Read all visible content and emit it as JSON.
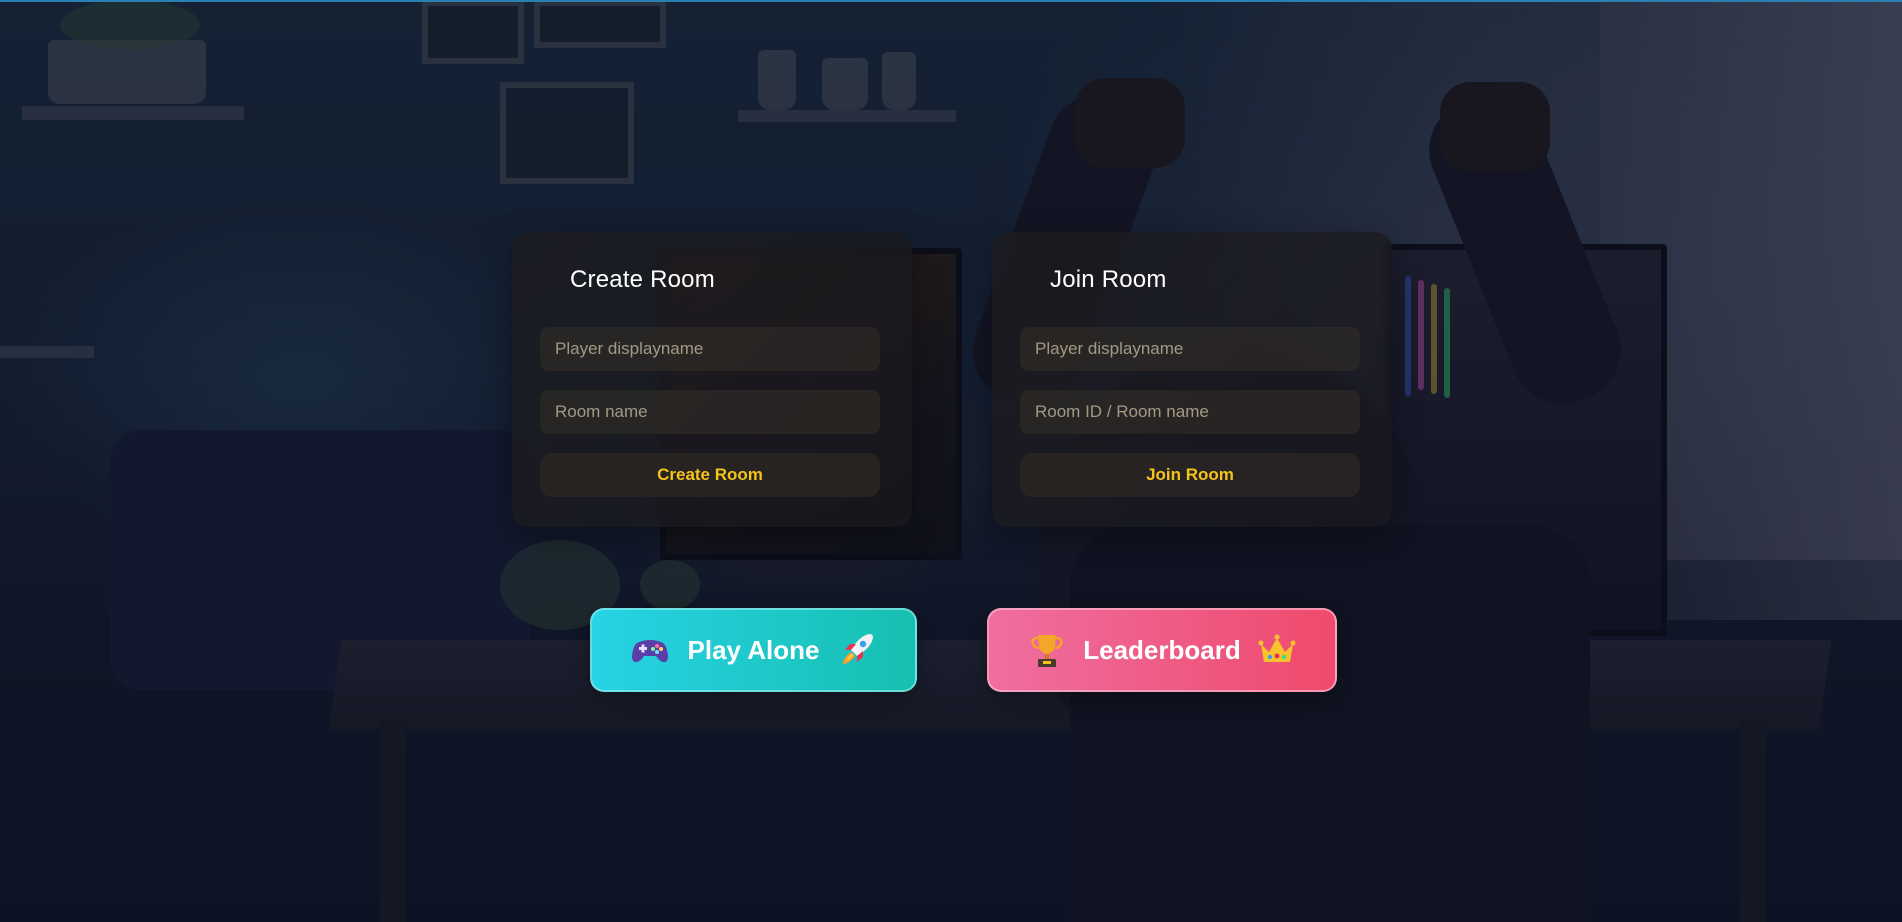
{
  "create_room": {
    "title": "Create Room",
    "name_placeholder": "Player displayname",
    "room_placeholder": "Room name",
    "button_label": "Create Room"
  },
  "join_room": {
    "title": "Join Room",
    "name_placeholder": "Player displayname",
    "room_placeholder": "Room ID / Room name",
    "button_label": "Join Room"
  },
  "actions": {
    "play_alone": {
      "label": "Play Alone",
      "left_icon": "gamepad-icon",
      "right_icon": "rocket-icon",
      "color_from": "#27d3e5",
      "color_to": "#16bfb0"
    },
    "leaderboard": {
      "label": "Leaderboard",
      "left_icon": "trophy-icon",
      "right_icon": "crown-icon",
      "color_from": "#ef6ea0",
      "color_to": "#ef4a6c"
    }
  },
  "colors": {
    "panel_button_text": "#f4c31c",
    "title_text": "#ffffff"
  }
}
